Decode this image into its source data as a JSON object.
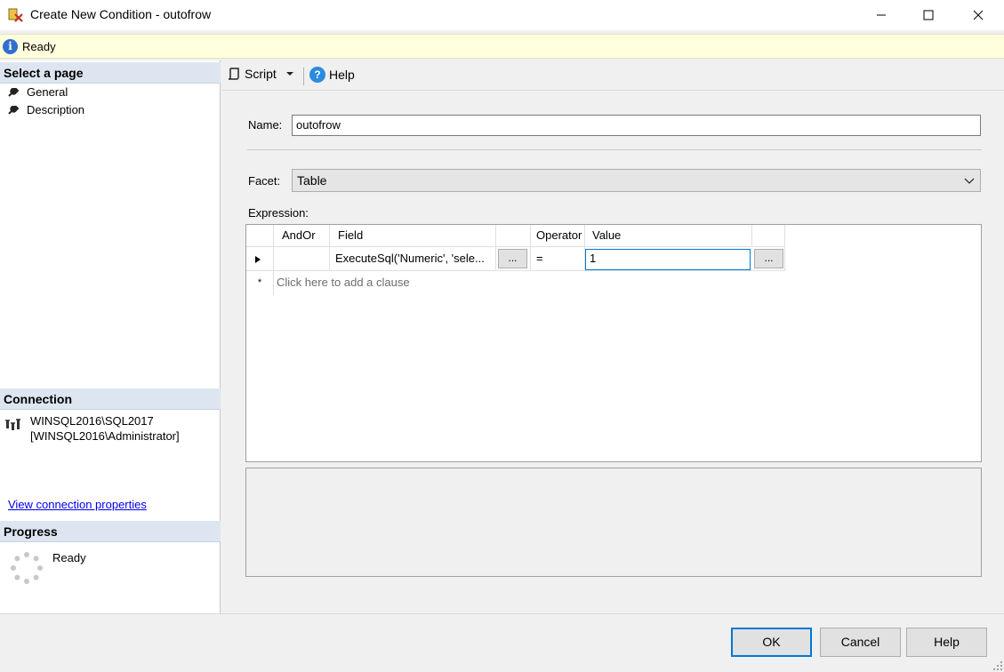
{
  "window": {
    "title": "Create New Condition - outofrow",
    "minimize": "—",
    "maximize": "☐",
    "close": "✕"
  },
  "infobar": {
    "status": "Ready"
  },
  "left": {
    "select_page_header": "Select a page",
    "pages": [
      {
        "label": "General",
        "icon": "wrench-icon"
      },
      {
        "label": "Description",
        "icon": "wrench-icon"
      }
    ],
    "connection_header": "Connection",
    "connection_server": "WINSQL2016\\SQL2017",
    "connection_user": "[WINSQL2016\\Administrator]",
    "view_connection_link": "View connection properties",
    "progress_header": "Progress",
    "progress_status": "Ready"
  },
  "toolbar": {
    "script_label": "Script",
    "help_label": "Help"
  },
  "form": {
    "name_label": "Name:",
    "name_value": "outofrow",
    "facet_label": "Facet:",
    "facet_value": "Table",
    "expression_label": "Expression:"
  },
  "grid": {
    "columns": [
      "AndOr",
      "Field",
      "",
      "Operator",
      "Value",
      ""
    ],
    "rows": [
      {
        "andor": "",
        "field": "ExecuteSql('Numeric', 'sele...",
        "operator": "=",
        "value": "1"
      }
    ],
    "add_row_marker": "*",
    "add_row_text": "Click here to add a clause",
    "ellipsis": "..."
  },
  "buttons": {
    "ok": "OK",
    "cancel": "Cancel",
    "help": "Help"
  },
  "colors": {
    "info_bar": "#fffedd",
    "section_header": "#dde6f0",
    "focus_blue": "#0078d7",
    "link": "#0000ee"
  }
}
